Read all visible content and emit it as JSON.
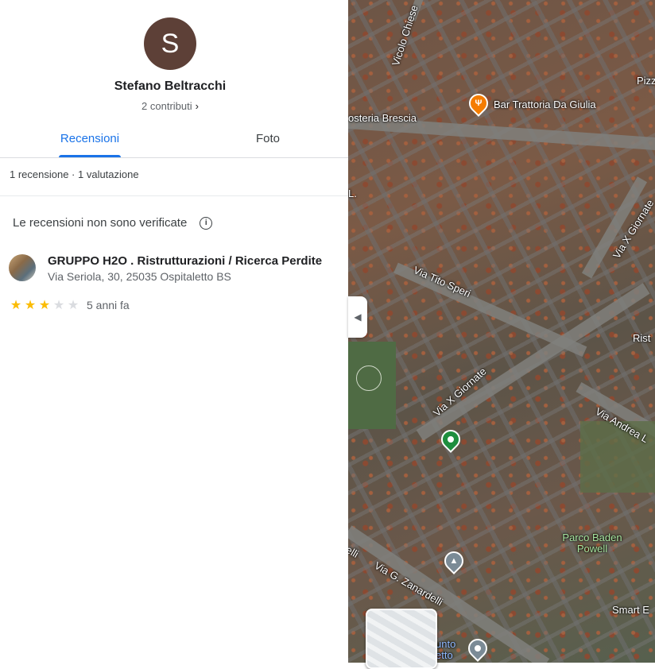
{
  "profile": {
    "initial": "S",
    "name": "Stefano Beltracchi",
    "contributions": "2 contributi",
    "avatar_color": "#5d4037"
  },
  "tabs": [
    {
      "label": "Recensioni",
      "active": true
    },
    {
      "label": "Foto",
      "active": false
    }
  ],
  "summary": "1 recensione · 1 valutazione",
  "notice": {
    "text": "Le recensioni non sono verificate",
    "icon": "info-icon"
  },
  "review": {
    "place_name": "GRUPPO H2O . Ristrutturazioni / Ricerca Perdite",
    "address": "Via Seriola, 30, 25035 Ospitaletto BS",
    "stars": 3,
    "max_stars": 5,
    "time_ago": "5 anni fa"
  },
  "map": {
    "labels": {
      "bar": "Bar Trattoria Da Giulia",
      "osteria": "osteria Brescia",
      "vicolo": "Vicolo Chiese",
      "tito": "Via Tito Speri",
      "giornate1": "Via X Giornate",
      "giornate2": "Via X Giornate",
      "andrea": "Via Andrea L",
      "zanardelli": "Via G. Zanardelli",
      "parco": "Parco Baden Powell",
      "smart": "Smart E",
      "pizz": "Pizz",
      "rist": "Rist",
      "punto": "unto etto",
      "elli": "elli",
      "l": "L."
    },
    "accent": "#1a73e8"
  }
}
